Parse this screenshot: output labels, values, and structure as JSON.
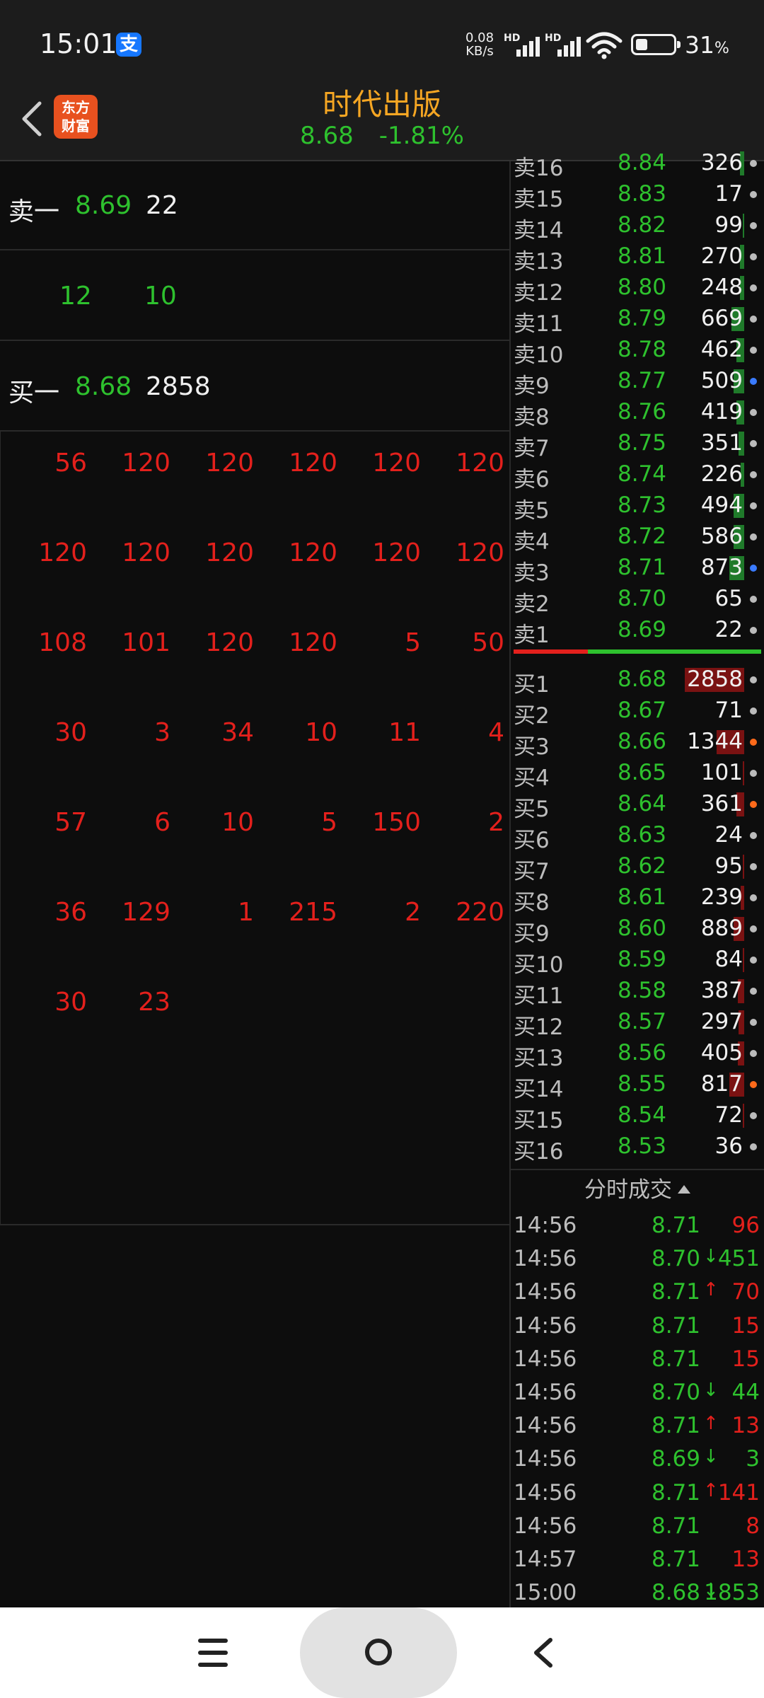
{
  "status_bar": {
    "time": "15:01",
    "alipay_glyph": "支",
    "net_speed_value": "0.08",
    "net_speed_unit": "KB/s",
    "hd": "HD",
    "battery_percent": "31",
    "battery_unit": "%",
    "battery_level": 0.31
  },
  "header": {
    "logo_line1": "东方",
    "logo_line2": "财富",
    "stock_name": "时代出版",
    "price": "8.68",
    "change": "-1.81%"
  },
  "left": {
    "sell1": {
      "label": "卖一",
      "price": "8.69",
      "volume": "22"
    },
    "queue_row": [
      "12",
      "10"
    ],
    "buy1": {
      "label": "买一",
      "price": "8.68",
      "volume": "2858"
    },
    "orders": [
      [
        "56",
        "120",
        "120",
        "120",
        "120",
        "120"
      ],
      [
        "120",
        "120",
        "120",
        "120",
        "120",
        "120"
      ],
      [
        "108",
        "101",
        "120",
        "120",
        "5",
        "50"
      ],
      [
        "30",
        "3",
        "34",
        "10",
        "11",
        "4"
      ],
      [
        "57",
        "6",
        "10",
        "5",
        "150",
        "2"
      ],
      [
        "36",
        "129",
        "1",
        "215",
        "2",
        "220"
      ],
      [
        "30",
        "23"
      ]
    ]
  },
  "book": {
    "asks": [
      {
        "level": "卖16",
        "price": "8.84",
        "volume": "326",
        "bar": 0.04,
        "dot": "grey"
      },
      {
        "level": "卖15",
        "price": "8.83",
        "volume": "17",
        "bar": 0.0,
        "dot": "grey"
      },
      {
        "level": "卖14",
        "price": "8.82",
        "volume": "99",
        "bar": 0.01,
        "dot": "grey"
      },
      {
        "level": "卖13",
        "price": "8.81",
        "volume": "270",
        "bar": 0.04,
        "dot": "grey"
      },
      {
        "level": "卖12",
        "price": "8.80",
        "volume": "248",
        "bar": 0.04,
        "dot": "grey"
      },
      {
        "level": "卖11",
        "price": "8.79",
        "volume": "669",
        "bar": 0.12,
        "dot": "grey"
      },
      {
        "level": "卖10",
        "price": "8.78",
        "volume": "462",
        "bar": 0.07,
        "dot": "grey"
      },
      {
        "level": "卖9",
        "price": "8.77",
        "volume": "509",
        "bar": 0.1,
        "dot": "blue"
      },
      {
        "level": "卖8",
        "price": "8.76",
        "volume": "419",
        "bar": 0.07,
        "dot": "grey"
      },
      {
        "level": "卖7",
        "price": "8.75",
        "volume": "351",
        "bar": 0.05,
        "dot": "grey"
      },
      {
        "level": "卖6",
        "price": "8.74",
        "volume": "226",
        "bar": 0.03,
        "dot": "grey"
      },
      {
        "level": "卖5",
        "price": "8.73",
        "volume": "494",
        "bar": 0.1,
        "dot": "grey"
      },
      {
        "level": "卖4",
        "price": "8.72",
        "volume": "586",
        "bar": 0.1,
        "dot": "grey"
      },
      {
        "level": "卖3",
        "price": "8.71",
        "volume": "873",
        "bar": 0.14,
        "dot": "blue"
      },
      {
        "level": "卖2",
        "price": "8.70",
        "volume": "65",
        "bar": 0.0,
        "dot": "grey"
      },
      {
        "level": "卖1",
        "price": "8.69",
        "volume": "22",
        "bar": 0.0,
        "dot": "grey"
      }
    ],
    "bids": [
      {
        "level": "买1",
        "price": "8.68",
        "volume": "2858",
        "bar": 0.56,
        "dot": "grey"
      },
      {
        "level": "买2",
        "price": "8.67",
        "volume": "71",
        "bar": 0.0,
        "dot": "grey"
      },
      {
        "level": "买3",
        "price": "8.66",
        "volume": "1344",
        "bar": 0.26,
        "dot": "orange"
      },
      {
        "level": "买4",
        "price": "8.65",
        "volume": "101",
        "bar": 0.01,
        "dot": "grey"
      },
      {
        "level": "买5",
        "price": "8.64",
        "volume": "361",
        "bar": 0.07,
        "dot": "orange"
      },
      {
        "level": "买6",
        "price": "8.63",
        "volume": "24",
        "bar": 0.0,
        "dot": "grey"
      },
      {
        "level": "买7",
        "price": "8.62",
        "volume": "95",
        "bar": 0.01,
        "dot": "grey"
      },
      {
        "level": "买8",
        "price": "8.61",
        "volume": "239",
        "bar": 0.03,
        "dot": "grey"
      },
      {
        "level": "买9",
        "price": "8.60",
        "volume": "889",
        "bar": 0.1,
        "dot": "grey"
      },
      {
        "level": "买10",
        "price": "8.59",
        "volume": "84",
        "bar": 0.01,
        "dot": "grey"
      },
      {
        "level": "买11",
        "price": "8.58",
        "volume": "387",
        "bar": 0.06,
        "dot": "grey"
      },
      {
        "level": "买12",
        "price": "8.57",
        "volume": "297",
        "bar": 0.05,
        "dot": "grey"
      },
      {
        "level": "买13",
        "price": "8.56",
        "volume": "405",
        "bar": 0.06,
        "dot": "grey"
      },
      {
        "level": "买14",
        "price": "8.55",
        "volume": "817",
        "bar": 0.14,
        "dot": "orange"
      },
      {
        "level": "买15",
        "price": "8.54",
        "volume": "72",
        "bar": 0.01,
        "dot": "grey"
      },
      {
        "level": "买16",
        "price": "8.53",
        "volume": "36",
        "bar": 0.0,
        "dot": "grey"
      }
    ],
    "bid_ratio": 0.3
  },
  "trades": {
    "header": "分时成交",
    "rows": [
      {
        "time": "14:56",
        "price": "8.71",
        "arrow": "",
        "volume": "96",
        "dir": "up"
      },
      {
        "time": "14:56",
        "price": "8.70",
        "arrow": "↓",
        "volume": "451",
        "dir": "down"
      },
      {
        "time": "14:56",
        "price": "8.71",
        "arrow": "↑",
        "volume": "70",
        "dir": "up"
      },
      {
        "time": "14:56",
        "price": "8.71",
        "arrow": "",
        "volume": "15",
        "dir": "up"
      },
      {
        "time": "14:56",
        "price": "8.71",
        "arrow": "",
        "volume": "15",
        "dir": "up"
      },
      {
        "time": "14:56",
        "price": "8.70",
        "arrow": "↓",
        "volume": "44",
        "dir": "down"
      },
      {
        "time": "14:56",
        "price": "8.71",
        "arrow": "↑",
        "volume": "13",
        "dir": "up"
      },
      {
        "time": "14:56",
        "price": "8.69",
        "arrow": "↓",
        "volume": "3",
        "dir": "down"
      },
      {
        "time": "14:56",
        "price": "8.71",
        "arrow": "↑",
        "volume": "141",
        "dir": "up"
      },
      {
        "time": "14:56",
        "price": "8.71",
        "arrow": "",
        "volume": "8",
        "dir": "up"
      },
      {
        "time": "14:57",
        "price": "8.71",
        "arrow": "",
        "volume": "13",
        "dir": "up"
      },
      {
        "time": "15:00",
        "price": "8.68",
        "arrow": "↓",
        "volume": "1853",
        "dir": "down"
      }
    ]
  },
  "colors": {
    "up": "#e3201c",
    "down": "#2ec12e",
    "accent": "#f5a623",
    "dot_grey": "#bbbbbb",
    "dot_blue": "#3a7bff",
    "dot_orange": "#ff6a1a",
    "ask_bar": "#1f7a2a",
    "bid_bar": "#7a1212"
  }
}
